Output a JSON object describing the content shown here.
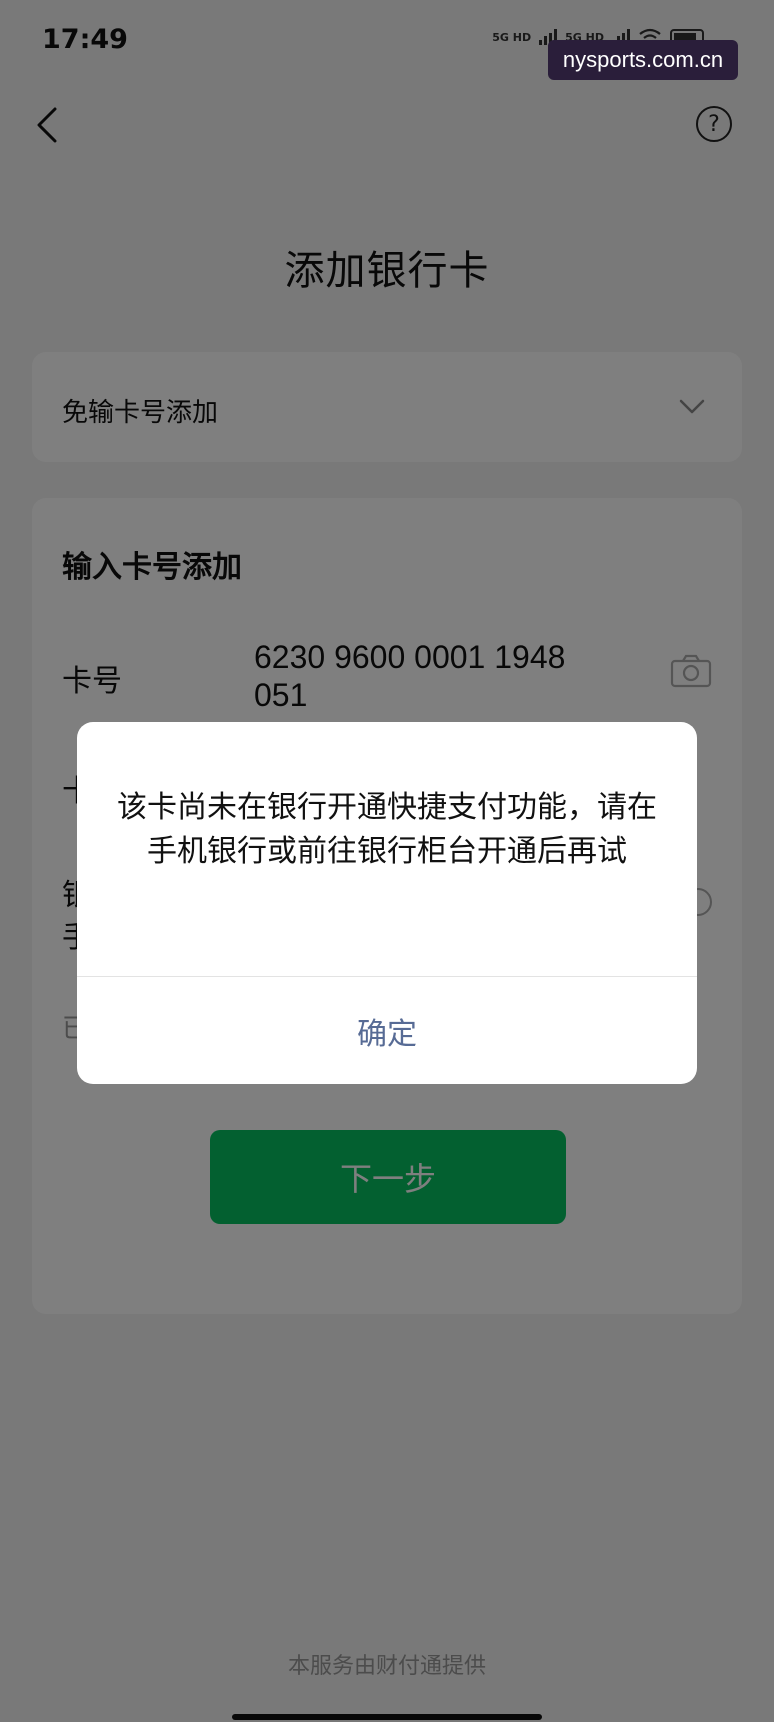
{
  "status_bar": {
    "time": "17:49",
    "network_1": "5G HD",
    "network_2": "5G HD"
  },
  "watermark": "nysports.com.cn",
  "header": {
    "back_icon": "chevron-left-icon",
    "help_icon": "question-circle-icon",
    "help_symbol": "?"
  },
  "page_title": "添加银行卡",
  "no_card_section": {
    "label": "免输卡号添加",
    "icon": "chevron-down-icon"
  },
  "card_input_section": {
    "title": "输入卡号添加",
    "card_number_label": "卡号",
    "card_number_value": "6230 9600 0001 1948 051",
    "camera_icon": "camera-icon",
    "next_button": "下一步"
  },
  "dialog": {
    "message": "该卡尚未在银行开通快捷支付功能，请在手机银行或前往银行柜台开通后再试",
    "confirm_button": "确定",
    "confirm_color": "#576b95"
  },
  "footer": "本服务由财付通提供",
  "colors": {
    "accent_green": "#07c160",
    "background": "#f2f2f2"
  }
}
